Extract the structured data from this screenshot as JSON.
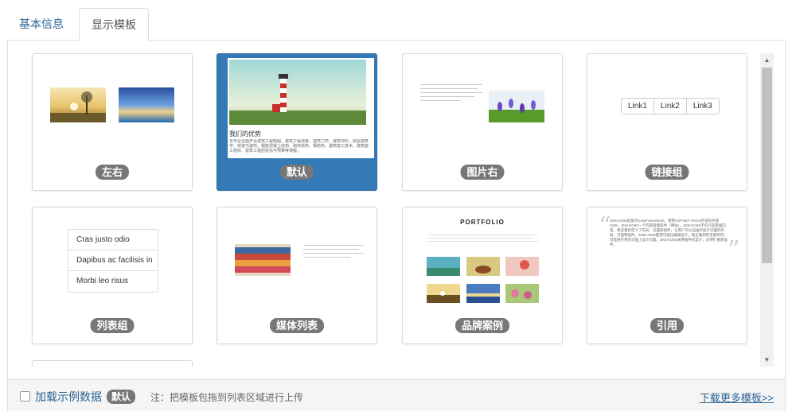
{
  "tabs": [
    {
      "label": "基本信息"
    },
    {
      "label": "显示模板"
    }
  ],
  "cards": [
    {
      "label": "左右"
    },
    {
      "label": "默认",
      "selected": true,
      "preview_heading": "我们的优势",
      "preview_body": "本专业全面开设建筑工程制图、建筑工程测量、建筑力学、建筑材料、房屋建筑学、房建与建构、钢筋混凝土结构、砌体结构、钢结构、建筑施工技术、建筑施工组织、建筑工程招投标与预算等课程。"
    },
    {
      "label": "图片右"
    },
    {
      "label": "链接组",
      "links": [
        "Link1",
        "Link2",
        "Link3"
      ]
    },
    {
      "label": "列表组",
      "items": [
        "Cras justo odio",
        "Dapibus ac facilisis in",
        "Morbi leo risus"
      ]
    },
    {
      "label": "媒体列表"
    },
    {
      "label": "品牌案例",
      "preview_heading": "PORTFOLIO"
    },
    {
      "label": "引用",
      "quote_link": "ZKEACMS",
      "quote_link2": "EasyFrameWork",
      "quote_text": "ZKEACMS是基于EasyFrameWork，使用ASP.NET MVC4开发的开源CMS。ZKEACMS一个内容管理软件（网站）。ZKEACMS不仅只是管理内容，更是重新定义了布局、页面和组件，让用户可以自由的设计页面的布局，页面和组件。ZKEACMS使用可视化编辑设计，真正做到所见即所得，可直接在预览页面上设计页面。ZKEACMS采用插件式设计，支持扩展新插件。"
    }
  ],
  "footer": {
    "load_label": "加载示例数据",
    "badge": "默认",
    "note": "注：把模板包拖到列表区域进行上传",
    "more_link": "下载更多模板>>"
  },
  "colors": {
    "accent": "#337ab7",
    "link": "#2a6496",
    "badge": "#777777"
  }
}
